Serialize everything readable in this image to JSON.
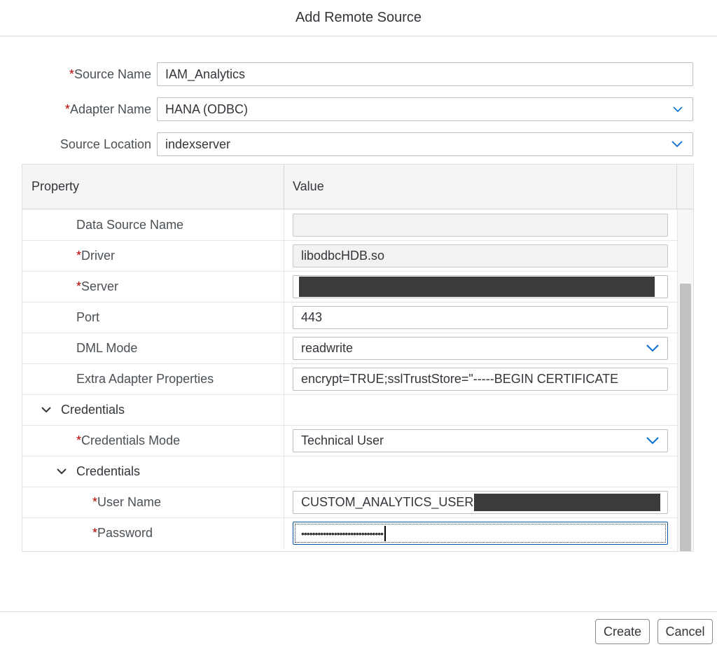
{
  "dialog": {
    "title": "Add Remote Source"
  },
  "form": {
    "source_name": {
      "label": "Source Name",
      "required": true,
      "value": "IAM_Analytics"
    },
    "adapter_name": {
      "label": "Adapter Name",
      "required": true,
      "value": "HANA (ODBC)"
    },
    "source_location": {
      "label": "Source Location",
      "required": false,
      "value": "indexserver"
    }
  },
  "table": {
    "columns": {
      "property": "Property",
      "value": "Value"
    },
    "rows": {
      "data_source_name": {
        "label": "Data Source Name",
        "value": ""
      },
      "driver": {
        "label": "Driver",
        "value": "libodbcHDB.so"
      },
      "server": {
        "label": "Server",
        "value": ""
      },
      "port": {
        "label": "Port",
        "value": "443"
      },
      "dml_mode": {
        "label": "DML Mode",
        "value": "readwrite"
      },
      "extra_adapter_properties": {
        "label": "Extra Adapter Properties",
        "value": "encrypt=TRUE;sslTrustStore=\"-----BEGIN CERTIFICATE"
      },
      "credentials_group": {
        "label": "Credentials"
      },
      "credentials_mode": {
        "label": "Credentials Mode",
        "value": "Technical User"
      },
      "credentials_subgroup": {
        "label": "Credentials"
      },
      "user_name": {
        "label": "User Name",
        "value": "CUSTOM_ANALYTICS_USER"
      },
      "password": {
        "label": "Password",
        "value": "••••••••••••••••••••••••••••••"
      }
    }
  },
  "required_marker": "*",
  "footer": {
    "create_label": "Create",
    "cancel_label": "Cancel"
  },
  "icons": {
    "select": "chevron-down-icon",
    "group": "chevron-down-icon"
  },
  "colors": {
    "required": "#bb0000",
    "focus": "#0854a0",
    "redaction": "#3b3b3b"
  }
}
